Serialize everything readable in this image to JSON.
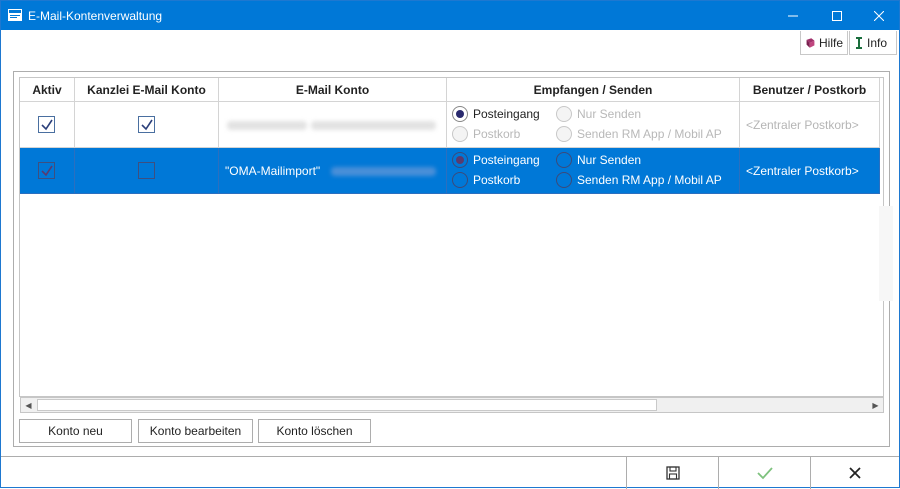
{
  "window": {
    "title": "E-Mail-Kontenverwaltung"
  },
  "toolbar": {
    "help_label": "Hilfe",
    "info_label": "Info"
  },
  "table": {
    "columns": [
      "Aktiv",
      "Kanzlei E-Mail Konto",
      "E-Mail Konto",
      "Empfangen / Senden",
      "Benutzer / Postkorb"
    ],
    "rows": [
      {
        "aktiv": true,
        "kanzlei": true,
        "email": "",
        "radio_posteingang": "Posteingang",
        "radio_postkorb": "Postkorb",
        "radio_nur_senden": "Nur Senden",
        "radio_senden_rm": "Senden RM App / Mobil AP",
        "postkorb": "<Zentraler Postkorb>"
      },
      {
        "aktiv": true,
        "kanzlei": false,
        "email": "\"OMA-Mailimport\"",
        "radio_posteingang": "Posteingang",
        "radio_postkorb": "Postkorb",
        "radio_nur_senden": "Nur Senden",
        "radio_senden_rm": "Senden RM App / Mobil AP",
        "postkorb": "<Zentraler Postkorb>"
      }
    ]
  },
  "actions": {
    "new_label": "Konto neu",
    "edit_label": "Konto bearbeiten",
    "delete_label": "Konto löschen"
  },
  "colors": {
    "accent": "#0078d7",
    "selection": "#0078d7"
  }
}
